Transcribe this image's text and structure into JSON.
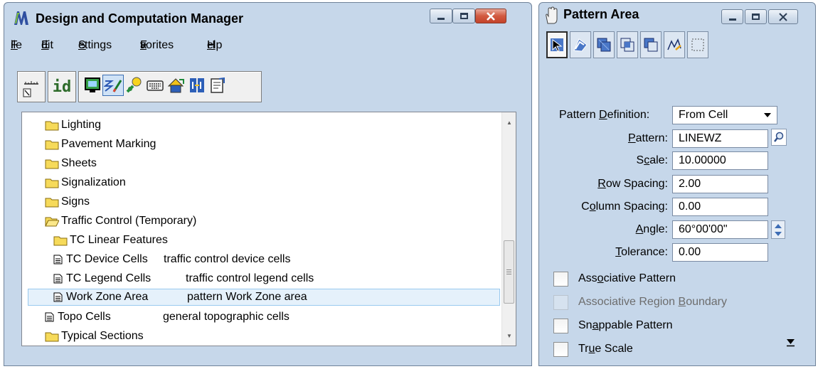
{
  "dcm": {
    "title": "Design and Computation Manager",
    "menu": [
      {
        "label": "File",
        "accel": "F",
        "rest": "ile"
      },
      {
        "label": "Edit",
        "accel": "E",
        "rest": "dit"
      },
      {
        "label": "Settings",
        "accel": "S",
        "rest": "ettings"
      },
      {
        "label": "Favorites",
        "accel": "a",
        "pre": "F",
        "rest": "vorites"
      },
      {
        "label": "Help",
        "accel": "H",
        "rest": "elp"
      }
    ],
    "toolbar": {
      "id_label": "id",
      "icons": [
        "ruler-icon",
        "id-icon",
        "monitor-icon",
        "edit-line-icon",
        "color-tool-icon",
        "keyboard-icon",
        "shapes-icon",
        "split-icon",
        "properties-icon"
      ]
    },
    "tree": [
      {
        "label": "Lighting",
        "type": "folder",
        "desc": ""
      },
      {
        "label": "Pavement Marking",
        "type": "folder",
        "desc": ""
      },
      {
        "label": "Sheets",
        "type": "folder",
        "desc": ""
      },
      {
        "label": "Signalization",
        "type": "folder",
        "desc": ""
      },
      {
        "label": "Signs",
        "type": "folder",
        "desc": ""
      },
      {
        "label": "Traffic Control (Temporary)",
        "type": "folder-open",
        "desc": ""
      },
      {
        "label": "TC Linear Features",
        "type": "folder",
        "desc": ""
      },
      {
        "label": "TC Device Cells",
        "type": "item",
        "desc": "traffic control device cells"
      },
      {
        "label": "TC Legend Cells",
        "type": "item",
        "desc": "traffic control legend cells"
      },
      {
        "label": "Work Zone Area",
        "type": "item",
        "desc": "pattern Work Zone area",
        "selected": true
      },
      {
        "label": "Topo Cells",
        "type": "item",
        "desc": "general topographic cells"
      },
      {
        "label": "Typical Sections",
        "type": "folder",
        "desc": ""
      }
    ]
  },
  "pattern": {
    "title": "Pattern Area",
    "tools": [
      "element-pattern-icon",
      "flood-pattern-icon",
      "union-pattern-icon",
      "intersection-pattern-icon",
      "difference-pattern-icon",
      "fence-pattern-icon",
      "points-pattern-icon"
    ],
    "definition_label": {
      "pre": "Pattern ",
      "accel": "D",
      "rest": "efinition:"
    },
    "definition_value": "From Cell",
    "pattern_label": {
      "pre": "",
      "accel": "P",
      "rest": "attern:"
    },
    "pattern_value": "LINEWZ",
    "scale_label": {
      "pre": "S",
      "accel": "c",
      "rest": "ale:"
    },
    "scale_value": "10.00000",
    "row_label": {
      "pre": "",
      "accel": "R",
      "rest": "ow Spacing:"
    },
    "row_value": "2.00",
    "column_label": {
      "pre": "C",
      "accel": "o",
      "rest": "lumn Spacing:"
    },
    "column_value": "0.00",
    "angle_label": {
      "pre": "",
      "accel": "A",
      "rest": "ngle:"
    },
    "angle_value": "60°00'00\"",
    "tolerance_label": {
      "pre": "",
      "accel": "T",
      "rest": "olerance:"
    },
    "tolerance_value": "0.00",
    "checkboxes": [
      {
        "pre": "Ass",
        "accel": "o",
        "rest": "ciative Pattern",
        "checked": false,
        "disabled": false
      },
      {
        "pre": "Associative Region ",
        "accel": "B",
        "rest": "oundary",
        "checked": false,
        "disabled": true
      },
      {
        "pre": "Sn",
        "accel": "a",
        "rest": "ppable Pattern",
        "checked": false,
        "disabled": false
      },
      {
        "pre": "Tr",
        "accel": "u",
        "rest": "e Scale",
        "checked": false,
        "disabled": false
      }
    ]
  }
}
